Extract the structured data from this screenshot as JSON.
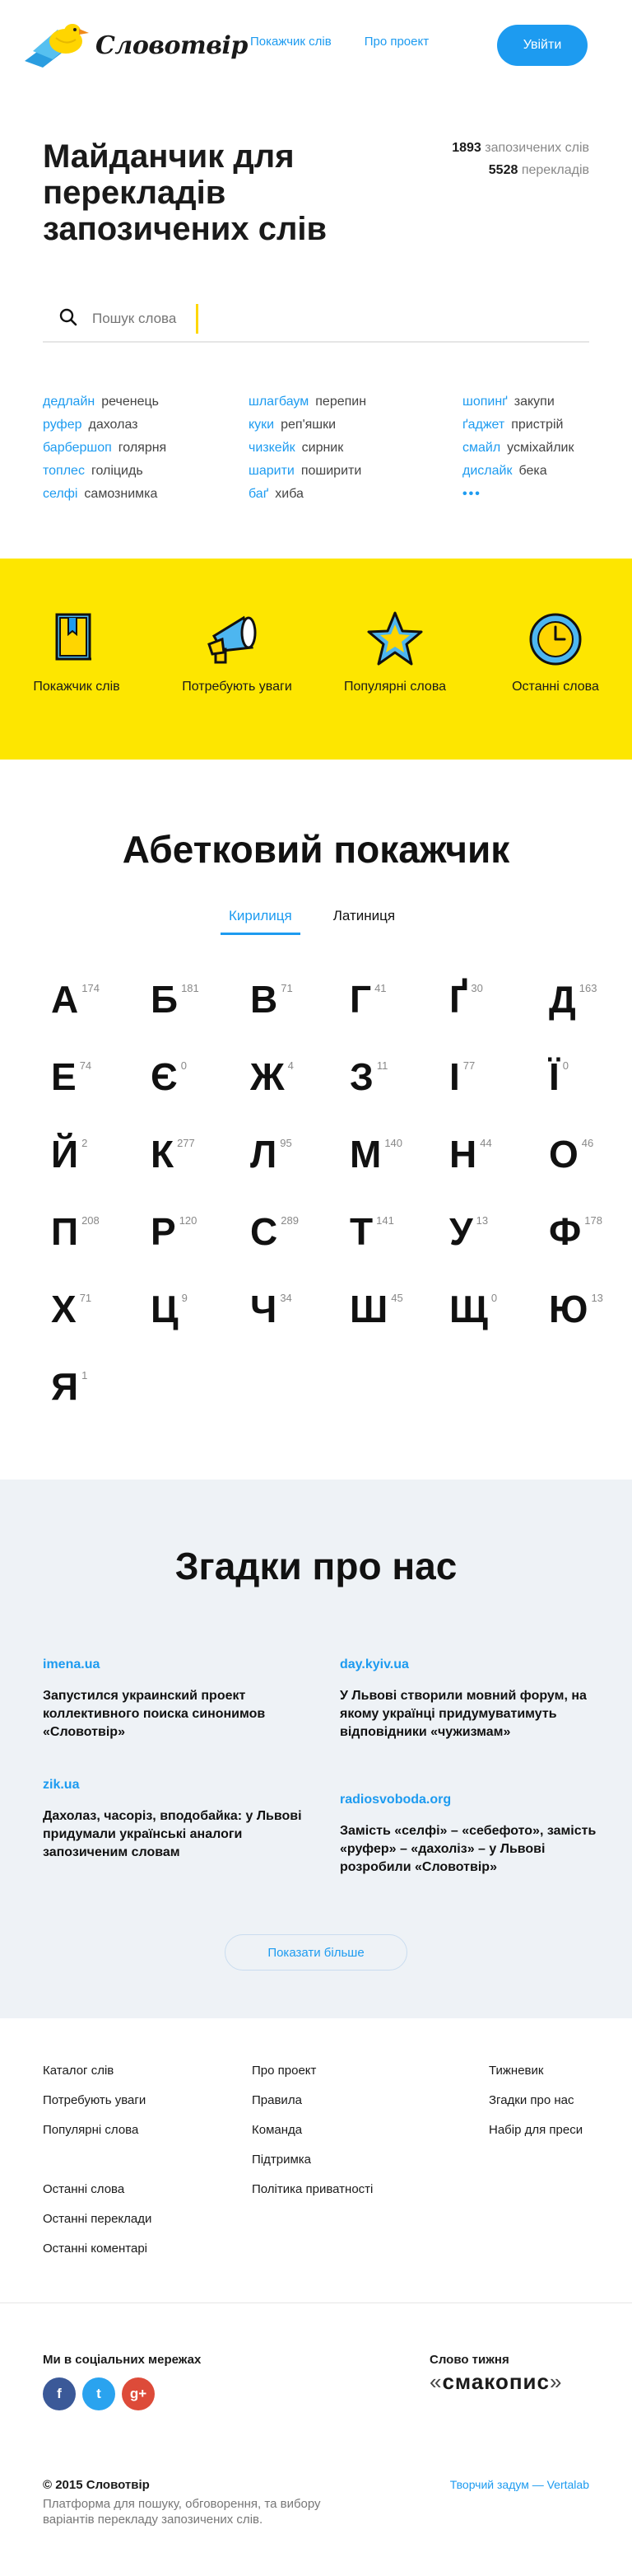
{
  "header": {
    "logo_text": "Словотвір",
    "nav": [
      "Покажчик слів",
      "Про проект"
    ],
    "login_label": "Увійти"
  },
  "hero": {
    "title": "Майданчик для перекладів запозичених слів",
    "stats": [
      {
        "value": "1893",
        "label": "запозичених слів"
      },
      {
        "value": "5528",
        "label": "перекладів"
      }
    ],
    "search_placeholder": "Пошук слова"
  },
  "pairs": {
    "col1": [
      {
        "foreign": "дедлайн",
        "native": "реченець"
      },
      {
        "foreign": "руфер",
        "native": "дахолаз"
      },
      {
        "foreign": "барбершоп",
        "native": "голярня"
      },
      {
        "foreign": "топлес",
        "native": "голіцидь"
      },
      {
        "foreign": "селфі",
        "native": "самознимка"
      }
    ],
    "col2": [
      {
        "foreign": "шлагбаум",
        "native": "перепин"
      },
      {
        "foreign": "куки",
        "native": "реп'яшки"
      },
      {
        "foreign": "чизкейк",
        "native": "сирник"
      },
      {
        "foreign": "шарити",
        "native": "поширити"
      },
      {
        "foreign": "баґ",
        "native": "хиба"
      }
    ],
    "col3": [
      {
        "foreign": "шопинґ",
        "native": "закупи"
      },
      {
        "foreign": "ґаджет",
        "native": "пристрій"
      },
      {
        "foreign": "смайл",
        "native": "усміхайлик"
      },
      {
        "foreign": "дислайк",
        "native": "бека"
      }
    ],
    "more": "•••"
  },
  "categories": [
    {
      "label": "Покажчик слів",
      "icon": "book-icon"
    },
    {
      "label": "Потребують уваги",
      "icon": "megaphone-icon"
    },
    {
      "label": "Популярні слова",
      "icon": "star-icon"
    },
    {
      "label": "Останні слова",
      "icon": "clock-icon"
    }
  ],
  "alphabet": {
    "title": "Абетковий покажчик",
    "tabs": [
      "Кирилиця",
      "Латиниця"
    ],
    "letters": [
      {
        "ch": "А",
        "n": "174"
      },
      {
        "ch": "Б",
        "n": "181"
      },
      {
        "ch": "В",
        "n": "71"
      },
      {
        "ch": "Г",
        "n": "41"
      },
      {
        "ch": "Ґ",
        "n": "30"
      },
      {
        "ch": "Д",
        "n": "163"
      },
      {
        "ch": "Е",
        "n": "74"
      },
      {
        "ch": "Є",
        "n": "0"
      },
      {
        "ch": "Ж",
        "n": "4"
      },
      {
        "ch": "З",
        "n": "11"
      },
      {
        "ch": "І",
        "n": "77"
      },
      {
        "ch": "Ї",
        "n": "0"
      },
      {
        "ch": "Й",
        "n": "2"
      },
      {
        "ch": "К",
        "n": "277"
      },
      {
        "ch": "Л",
        "n": "95"
      },
      {
        "ch": "М",
        "n": "140"
      },
      {
        "ch": "Н",
        "n": "44"
      },
      {
        "ch": "О",
        "n": "46"
      },
      {
        "ch": "П",
        "n": "208"
      },
      {
        "ch": "Р",
        "n": "120"
      },
      {
        "ch": "С",
        "n": "289"
      },
      {
        "ch": "Т",
        "n": "141"
      },
      {
        "ch": "У",
        "n": "13"
      },
      {
        "ch": "Ф",
        "n": "178"
      },
      {
        "ch": "Х",
        "n": "71"
      },
      {
        "ch": "Ц",
        "n": "9"
      },
      {
        "ch": "Ч",
        "n": "34"
      },
      {
        "ch": "Ш",
        "n": "45"
      },
      {
        "ch": "Щ",
        "n": "0"
      },
      {
        "ch": "Ю",
        "n": "13"
      },
      {
        "ch": "Я",
        "n": "1"
      }
    ]
  },
  "press": {
    "title": "Згадки про нас",
    "items": [
      {
        "source": "imena.ua",
        "title": "Запустился украинский проект коллективного поиска синонимов «Словотвір»"
      },
      {
        "source": "day.kyiv.ua",
        "title": "У Львові створили мовний форум, на якому українці придумуватимуть відповідники «чужизмам»"
      },
      {
        "source": "zik.ua",
        "title": "Дахолаз, часоріз, вподобайка: у Львові придумали українські аналоги запозиченим словам"
      },
      {
        "source": "radiosvoboda.org",
        "title": "Замість «селфі» – «себефото», замість «руфер» – «дахоліз» – у Львові розробили «Словотвір»"
      }
    ],
    "more_label": "Показати більше"
  },
  "footer": {
    "col1a": [
      "Каталог слів",
      "Потребують уваги",
      "Популярні слова"
    ],
    "col1b": [
      "Останні слова",
      "Останні переклади",
      "Останні коментарі"
    ],
    "col2": [
      "Про проект",
      "Правила",
      "Команда",
      "Підтримка",
      "Політика приватності"
    ],
    "col3": [
      "Тижневик",
      "Згадки про нас",
      "Набір для преси"
    ],
    "social_title": "Ми в соціальних мережах",
    "social": [
      {
        "icon": "facebook-icon",
        "glyph": "f",
        "color": "#3b5998"
      },
      {
        "icon": "twitter-icon",
        "glyph": "t",
        "color": "#2aa3ef"
      },
      {
        "icon": "google-plus-icon",
        "glyph": "g+",
        "color": "#dd4b39"
      }
    ],
    "word_title": "Слово тижня",
    "word_open": "«",
    "word": "смакопис",
    "word_close": "»",
    "copyright": "© 2015 Словотвір",
    "tagline": "Платформа для пошуку, обговорення, та вибору варіантів перекладу запозичених слів.",
    "credit": "Творчий задум — Vertalab"
  },
  "colors": {
    "accent": "#1d9bf0",
    "yellow": "#fde600",
    "press_bg": "#eef2f6"
  }
}
